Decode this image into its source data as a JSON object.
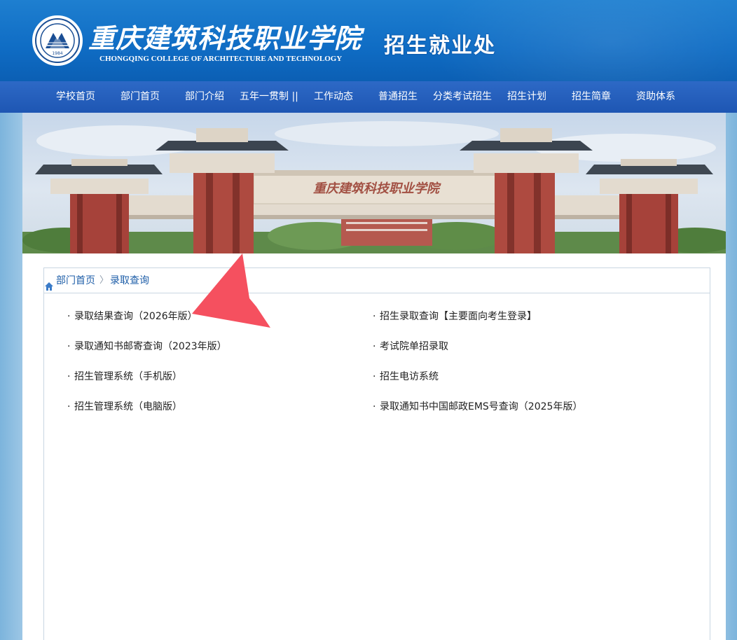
{
  "header": {
    "college_name_cn": "重庆建筑科技职业学院",
    "college_name_en": "CHONGQING COLLEGE OF ARCHITECTURE AND TECHNOLOGY",
    "emblem_year": "1984",
    "department": "招生就业处"
  },
  "nav": {
    "items": [
      {
        "label": "学校首页"
      },
      {
        "label": "部门首页"
      },
      {
        "label": "部门介绍"
      },
      {
        "label": "五年一贯制 ||"
      },
      {
        "label": "工作动态"
      },
      {
        "label": "普通招生"
      },
      {
        "label": "分类考试招生"
      },
      {
        "label": "招生计划"
      },
      {
        "label": "招生简章"
      },
      {
        "label": "资助体系"
      }
    ]
  },
  "banner": {
    "gate_text": "重庆建筑科技职业学院"
  },
  "breadcrumb": {
    "home": "部门首页",
    "separator": "〉",
    "current": "录取查询"
  },
  "links": {
    "left": [
      {
        "label": "录取结果查询（2026年版）"
      },
      {
        "label": "录取通知书邮寄查询（2023年版）"
      },
      {
        "label": "招生管理系统（手机版）"
      },
      {
        "label": "招生管理系统（电脑版）"
      }
    ],
    "right": [
      {
        "label": "招生录取查询【主要面向考生登录】"
      },
      {
        "label": "考试院单招录取"
      },
      {
        "label": "招生电访系统"
      },
      {
        "label": "录取通知书中国邮政EMS号查询（2025年版）"
      }
    ],
    "bullet": "·"
  },
  "colors": {
    "header_blue": "#0f6cc4",
    "nav_blue": "#1e56b3",
    "link_blue": "#1e5ea8",
    "arrow_red": "#f5505f"
  }
}
